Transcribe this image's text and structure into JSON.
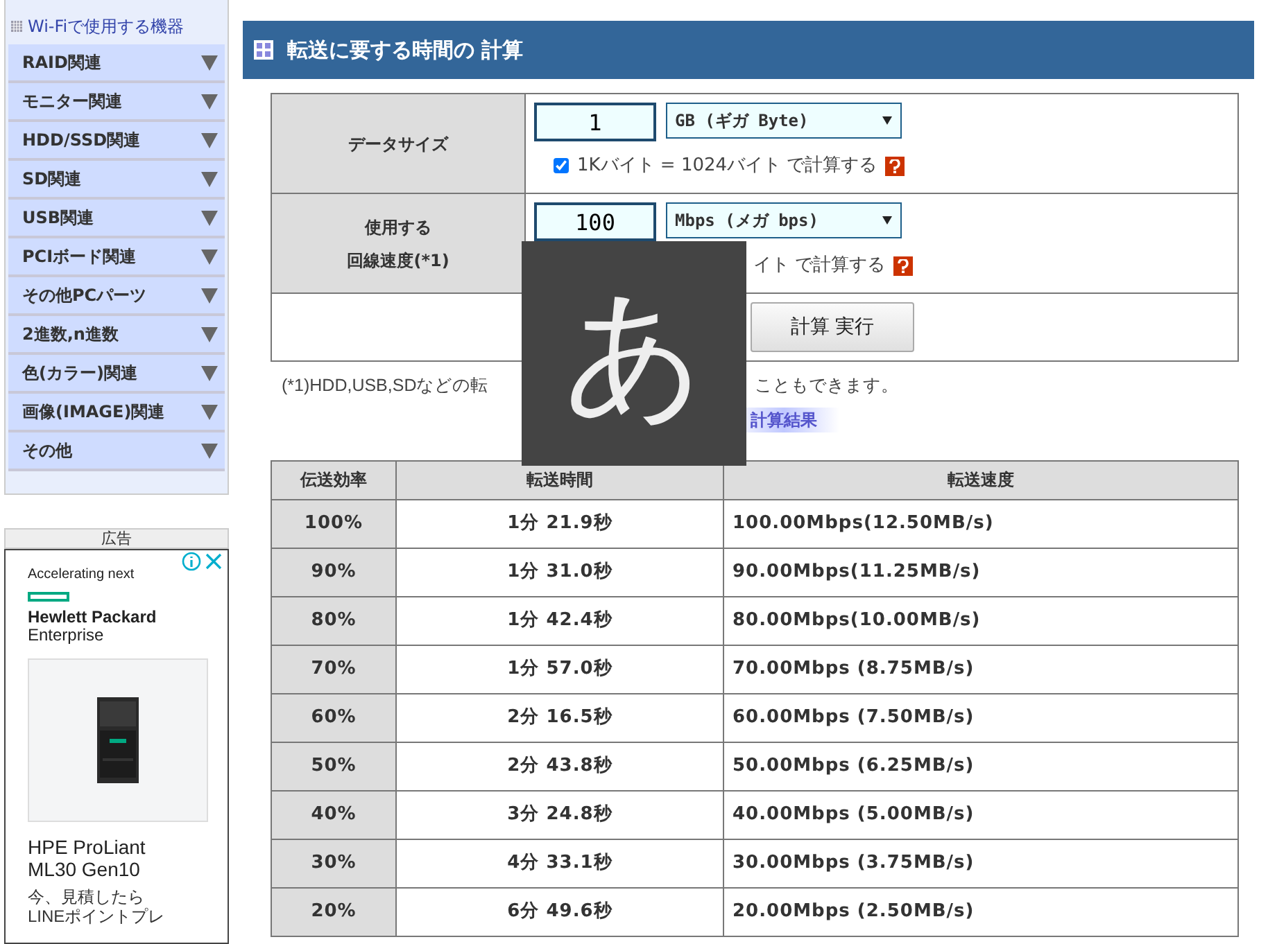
{
  "sidebar": {
    "heading": "Wi-Fiで使用する機器",
    "items": [
      {
        "label": "RAID関連",
        "expanded": false
      },
      {
        "label": "モニター関連",
        "expanded": false
      },
      {
        "label": "HDD/SSD関連",
        "expanded": false
      },
      {
        "label": "SD関連",
        "expanded": false
      },
      {
        "label": "USB関連",
        "expanded": false
      },
      {
        "label": "PCIボード関連",
        "expanded": false
      },
      {
        "label": "その他PCパーツ",
        "expanded": false
      },
      {
        "label": "2進数,n進数",
        "expanded": false
      },
      {
        "label": "色(カラー)関連",
        "expanded": false
      },
      {
        "label": "画像(IMAGE)関連",
        "expanded": false
      },
      {
        "label": "その他",
        "expanded": false
      }
    ]
  },
  "ad": {
    "label": "広告",
    "tagline": "Accelerating next",
    "brand_line1": "Hewlett Packard",
    "brand_line2": "Enterprise",
    "product_line1": "HPE ProLiant",
    "product_line2": "ML30 Gen10",
    "promo": "今、見積したらLINEポイントプレ"
  },
  "main": {
    "title": "転送に要する時間の 計算",
    "form": {
      "rows": [
        {
          "label_lines": [
            "データサイズ"
          ],
          "value": "1",
          "unit": "GB (ギガ Byte)",
          "checkbox_label": "1Kバイト = 1024バイト で計算する",
          "checked": true
        },
        {
          "label_lines": [
            "使用する",
            "回線速度(*1)"
          ],
          "value": "100",
          "unit": "Mbps (メガ bps)",
          "checkbox_label": "イト で計算する"
        }
      ],
      "button": "計算 実行"
    },
    "note_parts": [
      "(*1)HDD,USB,SDなどの転",
      "こともできます。"
    ],
    "result_label": "計算結果",
    "table": {
      "columns": [
        "伝送効率",
        "転送時間",
        "転送速度"
      ],
      "rows": [
        [
          "100%",
          "1分 21.9秒",
          "100.00Mbps(12.50MB/s)"
        ],
        [
          "90%",
          "1分 31.0秒",
          "90.00Mbps(11.25MB/s)"
        ],
        [
          "80%",
          "1分 42.4秒",
          "80.00Mbps(10.00MB/s)"
        ],
        [
          "70%",
          "1分 57.0秒",
          "70.00Mbps (8.75MB/s)"
        ],
        [
          "60%",
          "2分 16.5秒",
          "60.00Mbps (7.50MB/s)"
        ],
        [
          "50%",
          "2分 43.8秒",
          "50.00Mbps (6.25MB/s)"
        ],
        [
          "40%",
          "3分 24.8秒",
          "40.00Mbps (5.00MB/s)"
        ],
        [
          "30%",
          "4分 33.1秒",
          "30.00Mbps (3.75MB/s)"
        ],
        [
          "20%",
          "6分 49.6秒",
          "20.00Mbps (2.50MB/s)"
        ]
      ]
    }
  },
  "ime_indicator": "あ"
}
